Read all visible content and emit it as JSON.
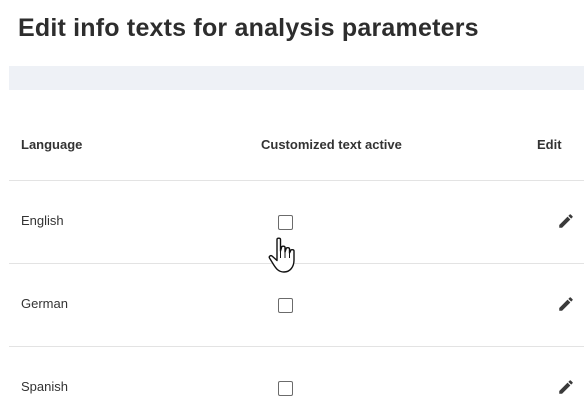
{
  "page": {
    "title": "Edit info texts for analysis parameters"
  },
  "table": {
    "columns": {
      "language": "Language",
      "customized_text_active": "Customized text active",
      "edit": "Edit"
    },
    "rows": [
      {
        "language": "English",
        "customized_text_active": false
      },
      {
        "language": "German",
        "customized_text_active": false
      },
      {
        "language": "Spanish",
        "customized_text_active": false
      }
    ]
  },
  "icons": {
    "edit": "pencil-icon",
    "cursor": "hand-pointer-icon"
  },
  "colors": {
    "subheader_bar": "#eef1f6",
    "row_divider": "#e3e3e3",
    "text": "#333333"
  }
}
